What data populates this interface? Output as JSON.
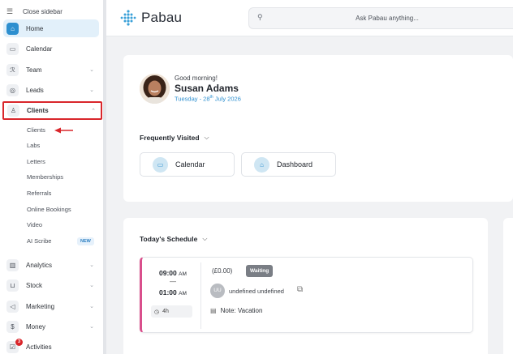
{
  "sidebar": {
    "close_label": "Close sidebar",
    "items": [
      {
        "label": "Home"
      },
      {
        "label": "Calendar"
      },
      {
        "label": "Team"
      },
      {
        "label": "Leads"
      },
      {
        "label": "Clients"
      },
      {
        "label": "Analytics"
      },
      {
        "label": "Stock"
      },
      {
        "label": "Marketing"
      },
      {
        "label": "Money"
      },
      {
        "label": "Activities",
        "badge": "3"
      }
    ],
    "clients_sub": [
      "Clients",
      "Labs",
      "Letters",
      "Memberships",
      "Referrals",
      "Online Bookings",
      "Video",
      "AI Scribe"
    ],
    "new_badge": "NEW",
    "highlight_color": "#d9262b"
  },
  "header": {
    "brand": "Pabau",
    "search_placeholder": "Ask Pabau anything..."
  },
  "greeting": {
    "hello": "Good morning!",
    "name": "Susan Adams",
    "date_prefix": "Tuesday - 28",
    "date_sup": "th",
    "date_suffix": " July 2026"
  },
  "frequent": {
    "title": "Frequently Visited",
    "items": [
      {
        "label": "Calendar"
      },
      {
        "label": "Dashboard"
      }
    ]
  },
  "schedule": {
    "title": "Today's Schedule",
    "appointment": {
      "start": "09:00",
      "start_ampm": "AM",
      "dash": "—",
      "end": "01:00",
      "end_ampm": "AM",
      "duration": "4h",
      "price": "(£0.00)",
      "status": "Waiting",
      "initials": "UU",
      "client": "undefined undefined",
      "note": "Note: Vacation"
    }
  }
}
